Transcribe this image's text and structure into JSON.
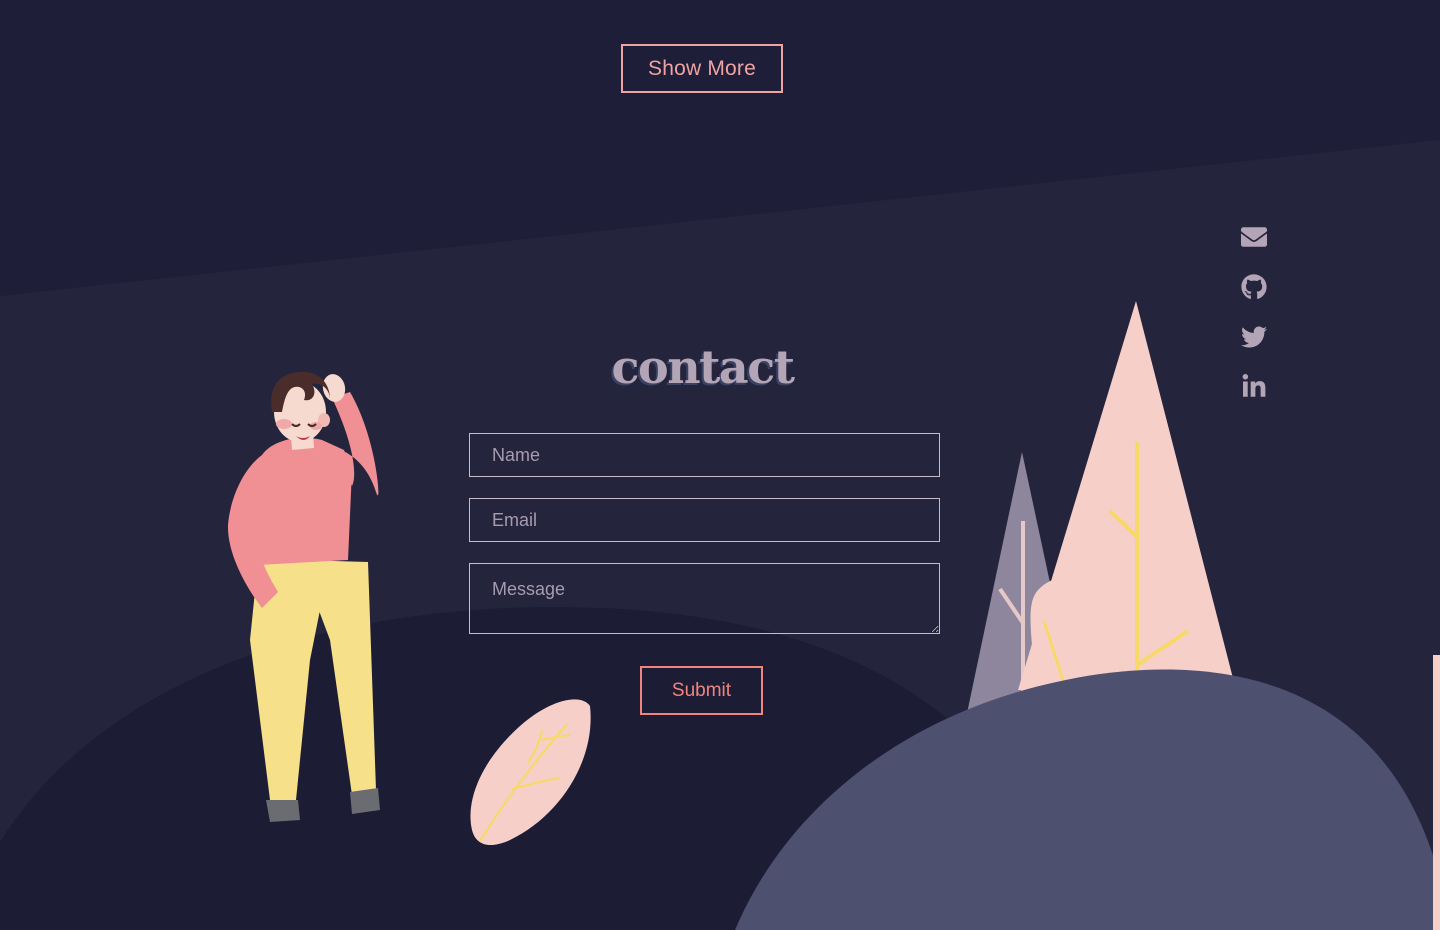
{
  "page": {
    "title": "contact",
    "bg_top": "#1e1e38",
    "bg_mid": "#24243c",
    "hill_dark": "#1c1c34",
    "hill_slate": "#4e5070",
    "accent_pink": "#f0a3a3",
    "accent_coral": "#f0857d",
    "heading_color": "#b3a5b5",
    "heading_shadow": "#3a4266",
    "strip_color": "#f5cfc8"
  },
  "show_more": {
    "label": "Show More"
  },
  "form": {
    "name": {
      "placeholder": "Name",
      "value": ""
    },
    "email": {
      "placeholder": "Email",
      "value": ""
    },
    "message": {
      "placeholder": "Message",
      "value": ""
    },
    "submit_label": "Submit"
  },
  "social": [
    {
      "name": "email",
      "icon": "envelope-icon",
      "label": "Email"
    },
    {
      "name": "github",
      "icon": "github-icon",
      "label": "GitHub"
    },
    {
      "name": "twitter",
      "icon": "twitter-icon",
      "label": "Twitter"
    },
    {
      "name": "linkedin",
      "icon": "linkedin-icon",
      "label": "LinkedIn"
    }
  ],
  "illustration": {
    "character": {
      "name": "waving-person",
      "hair": "#4a2c2a",
      "skin": "#f6d9cf",
      "sweater": "#f08f94",
      "pants": "#f7e08a",
      "shoes": "#6b6b72"
    },
    "trees": [
      {
        "name": "tall-pink-tree",
        "color": "#f6cfc9",
        "branch": "#f7d96a"
      },
      {
        "name": "short-mauve-tree",
        "color": "#8e869c",
        "branch": "#e6c8c8"
      },
      {
        "name": "leaf-tree",
        "color": "#f6cfc9",
        "branch": "#f7d96a"
      }
    ],
    "leaf": {
      "name": "pink-leaf",
      "color": "#f6cfc9",
      "vein": "#f7d96a"
    }
  }
}
